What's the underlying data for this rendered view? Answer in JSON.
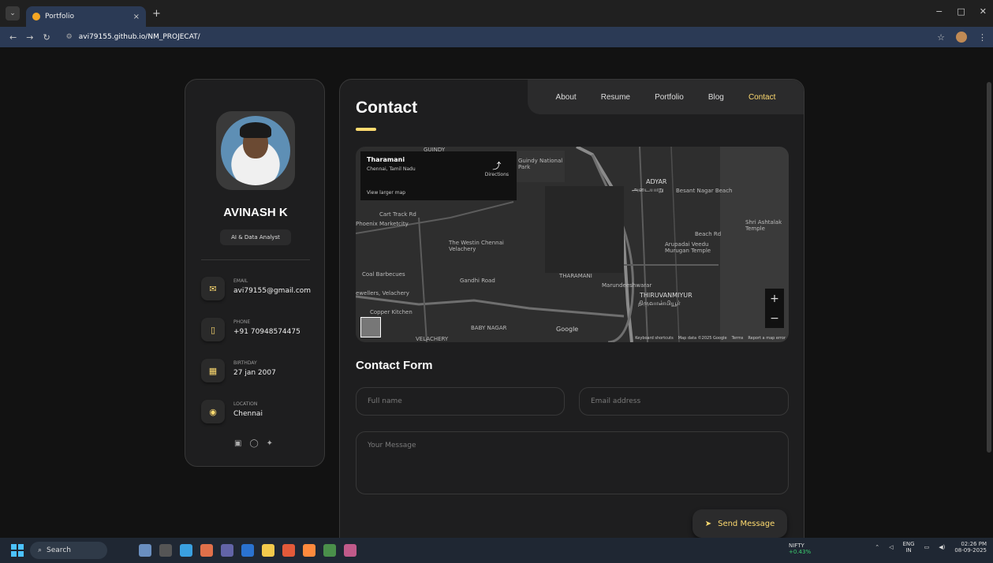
{
  "browser": {
    "tab_title": "Portfolio",
    "tab_close": "×",
    "new_tab": "+",
    "url": "avi79155.github.io/NM_PROJECAT/",
    "win_min": "−",
    "win_max": "□",
    "win_close": "✕"
  },
  "sidebar": {
    "name": "AVINASH K",
    "role": "AI & Data Analyst",
    "contacts": [
      {
        "label": "EMAIL",
        "value": "avi79155@gmail.com"
      },
      {
        "label": "PHONE",
        "value": "+91 70948574475"
      },
      {
        "label": "BIRTHDAY",
        "value": "27 jan 2007"
      },
      {
        "label": "LOCATION",
        "value": "Chennai"
      }
    ]
  },
  "nav": {
    "items": [
      "About",
      "Resume",
      "Portfolio",
      "Blog",
      "Contact"
    ],
    "active": "Contact"
  },
  "main": {
    "title": "Contact",
    "form_title": "Contact Form",
    "placeholders": {
      "fullname": "Full name",
      "email": "Email address",
      "message": "Your Message"
    },
    "send_label": "Send Message"
  },
  "map": {
    "card_title": "Tharamani",
    "card_sub": "Chennai, Tamil Nadu",
    "card_link": "View larger map",
    "directions": "Directions",
    "labels": {
      "guindy": "GUINDY",
      "guindy_park": "Guindy National Park",
      "adyar": "ADYAR",
      "adyar_ta": "அடையாறு",
      "besant": "Besant Nagar Beach",
      "cart": "Cart Track Rd",
      "phoenix": "Phoenix Marketcity",
      "westin": "The Westin Chennai Velachery",
      "beach_rd": "Beach Rd",
      "shri": "Shri Ashtalak Temple",
      "arupadai": "Arupadai Veedu Murugan Temple",
      "coal": "Coal Barbecues",
      "gandhi": "Gandhi Road",
      "tharamani": "THARAMANI",
      "marundeeshwarar": "Marundeeshwarar",
      "thiruvanmiyur": "THIRUVANMIYUR",
      "thiruvanmiyur_ta": "திருவான்மியூர்",
      "jewellers": "ewellers, Velachery",
      "copper": "Copper Kitchen",
      "baby": "BABY NAGAR",
      "velachery": "VELACHERY",
      "google": "Google"
    },
    "footer": [
      "Keyboard shortcuts",
      "Map data ©2025 Google",
      "Terms",
      "Report a map error"
    ],
    "zoom_in": "+",
    "zoom_out": "−"
  },
  "taskbar": {
    "search": "Search",
    "nifty_label": "NIFTY",
    "nifty_change": "+0.43%",
    "lang": "ENG",
    "region": "IN",
    "time": "02:26 PM",
    "date": "08-09-2025"
  }
}
